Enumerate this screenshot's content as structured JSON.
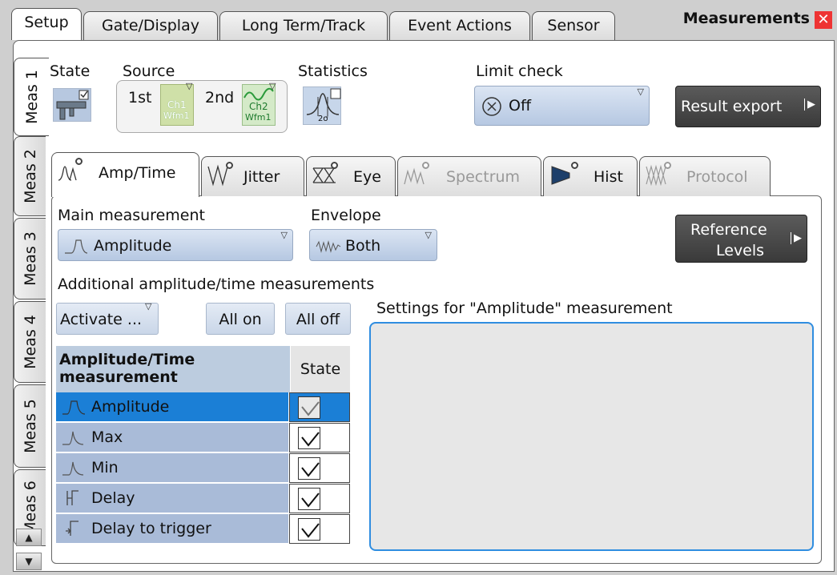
{
  "window": {
    "title": "Measurements",
    "close_glyph": "✕"
  },
  "top_tabs": [
    {
      "label": "Setup"
    },
    {
      "label": "Gate/Display"
    },
    {
      "label": "Long Term/Track"
    },
    {
      "label": "Event Actions"
    },
    {
      "label": "Sensor"
    }
  ],
  "side_tabs": [
    {
      "label": "Meas 1"
    },
    {
      "label": "Meas 2"
    },
    {
      "label": "Meas 3"
    },
    {
      "label": "Meas 4"
    },
    {
      "label": "Meas 5"
    },
    {
      "label": "Meas 6"
    }
  ],
  "setup": {
    "state_label": "State",
    "source_label": "Source",
    "source_1st": "1st",
    "source_2nd": "2nd",
    "source1_value": "Ch1\nWfm1",
    "source1_line1": "Ch1",
    "source1_line2": "Wfm1",
    "source2_line1": "Ch2",
    "source2_line2": "Wfm1",
    "statistics_label": "Statistics",
    "statistics_sub": "2σ",
    "limit_label": "Limit check",
    "limit_value": "Off",
    "result_export": "Result export"
  },
  "sub_tabs": [
    {
      "label": "Amp/Time",
      "enabled": true
    },
    {
      "label": "Jitter",
      "enabled": true
    },
    {
      "label": "Eye",
      "enabled": true
    },
    {
      "label": "Spectrum",
      "enabled": false
    },
    {
      "label": "Hist",
      "enabled": true
    },
    {
      "label": "Protocol",
      "enabled": false
    }
  ],
  "amp_time": {
    "main_label": "Main measurement",
    "main_value": "Amplitude",
    "envelope_label": "Envelope",
    "envelope_value": "Both",
    "reference_levels_line1": "Reference",
    "reference_levels_line2": "Levels",
    "additional_label": "Additional amplitude/time measurements",
    "activate": "Activate ...",
    "all_on": "All on",
    "all_off": "All off",
    "settings_label": "Settings for \"Amplitude\" measurement",
    "table": {
      "header_main": "Amplitude/Time measurement",
      "header_state": "State",
      "rows": [
        {
          "name": "Amplitude",
          "checked": true,
          "selected": true
        },
        {
          "name": "Max",
          "checked": true,
          "selected": false
        },
        {
          "name": "Min",
          "checked": true,
          "selected": false
        },
        {
          "name": "Delay",
          "checked": true,
          "selected": false
        },
        {
          "name": "Delay to trigger",
          "checked": true,
          "selected": false
        }
      ]
    }
  },
  "colors": {
    "selected_row": "#1b7fd6",
    "settings_border": "#2f8de0",
    "close": "#e33333"
  }
}
